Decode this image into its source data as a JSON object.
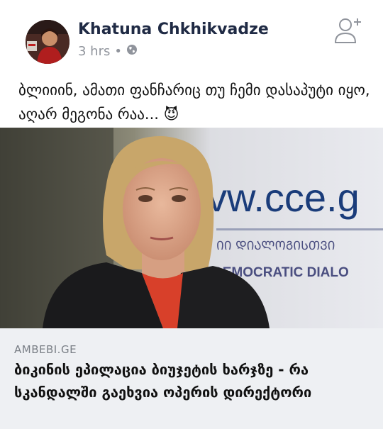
{
  "post": {
    "author_name": "Khatuna Chkhikvadze",
    "time": "3 hrs",
    "separator": "•",
    "privacy_icon": "globe-icon",
    "add_friend_icon": "person-plus-icon",
    "text": "ბლიიინ, ამათი ფანჩარიც თუ ჩემი დასაპუტი იყო, აღარ მეგონა რაა... 😈"
  },
  "link_preview": {
    "sign_text": "vw.cce.g",
    "banner_script": "ᲘᲘ ᲓᲘᲐᲚᲝᲒᲘᲡᲗᲕᲘ",
    "banner_text": "DEMOCRATIC DIALO",
    "source": "AMBEBI.GE",
    "headline": "ბიკინის ეპილაცია ბიუჯეტის ხარჯზე - რა სკანდალში გაეხვია ოპერის დირექტორი"
  },
  "colors": {
    "author": "#1f2a44",
    "meta": "#90949c",
    "caption_bg": "#eef0f3",
    "sign_text": "#1a3c7a",
    "banner_text": "#4a4e80"
  }
}
